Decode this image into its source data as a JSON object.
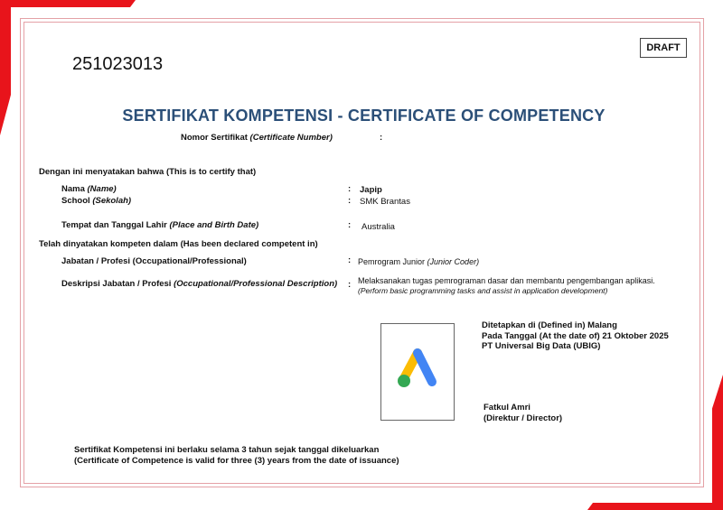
{
  "certificate": {
    "id_number": "251023013",
    "draft_badge": "DRAFT",
    "title": "SERTIFIKAT KOMPETENSI - CERTIFICATE OF COMPETENCY",
    "number_label": "Nomor Sertifikat",
    "number_label_en": "(Certificate Number)",
    "number_colon": ":"
  },
  "certify": {
    "heading": "Dengan ini menyatakan bahwa (This is to certify that)",
    "fields": [
      {
        "label": "Nama",
        "label_en": "(Name)",
        "value": "Japip"
      },
      {
        "label": "School",
        "label_en": "(Sekolah)",
        "value": "SMK Brantas"
      },
      {
        "label": "Tempat dan Tanggal Lahir",
        "label_en": "(Place and Birth Date)",
        "value": "Australia"
      }
    ]
  },
  "competent": {
    "heading": "Telah dinyatakan kompeten dalam (Has been declared competent in)",
    "position_label": "Jabatan / Profesi (Occupational/Professional)",
    "position_value": "Pemrogram Junior",
    "position_value_en": "(Junior Coder)",
    "description_label": "Deskripsi Jabatan / Profesi",
    "description_label_en": "(Occupational/Professional Description)",
    "description_value": "Melaksanakan tugas pemrograman dasar dan membantu pengembangan aplikasi.",
    "description_value_en": "(Perform basic programming tasks and assist in application development)"
  },
  "colon": ":",
  "issuance": {
    "place_line": "Ditetapkan di (Defined in) Malang",
    "date_line": "Pada Tanggal (At the date of) 21 Oktober 2025",
    "org_line": "PT Universal Big Data (UBIG)",
    "signer_name": "Fatkul Amri",
    "signer_title": "(Direktur / Director)"
  },
  "validity": {
    "line_id": "Sertifikat Kompetensi ini berlaku selama 3 tahun sejak tanggal dikeluarkan",
    "line_en": "(Certificate of Competence is valid for three (3) years from the date of issuance)"
  },
  "colors": {
    "accent_red": "#e8141b",
    "frame": "#e4a1a6",
    "title_blue": "#2b4f78",
    "logo_yellow": "#fbbc04",
    "logo_blue": "#4285f4",
    "logo_green": "#34a853"
  },
  "icons": {
    "logo": "google-ads-logo-icon"
  }
}
